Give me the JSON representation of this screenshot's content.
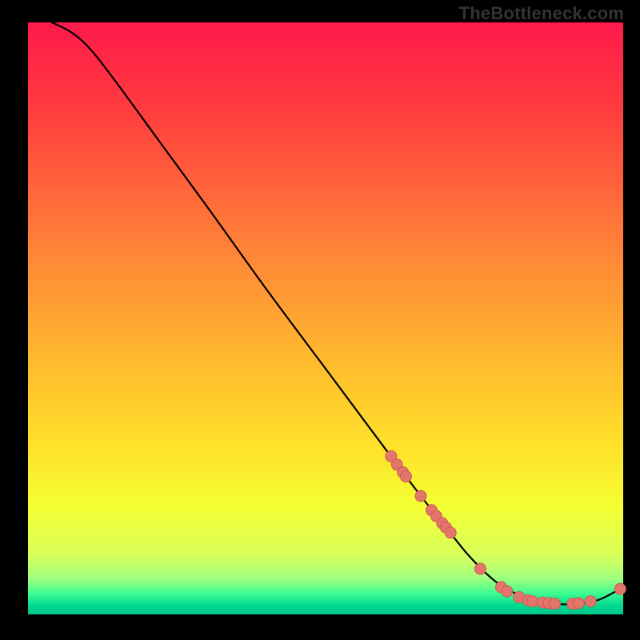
{
  "watermark": "TheBottleneck.com",
  "plot": {
    "inner_x": 35,
    "inner_y": 28,
    "inner_w": 744,
    "inner_h": 740
  },
  "gradient_stops": [
    {
      "offset": 0.0,
      "color": "#ff1a4b"
    },
    {
      "offset": 0.14,
      "color": "#ff3a3f"
    },
    {
      "offset": 0.3,
      "color": "#ff6a3a"
    },
    {
      "offset": 0.46,
      "color": "#ff9a34"
    },
    {
      "offset": 0.6,
      "color": "#ffc22d"
    },
    {
      "offset": 0.72,
      "color": "#ffe22a"
    },
    {
      "offset": 0.82,
      "color": "#f4ff34"
    },
    {
      "offset": 0.9,
      "color": "#d8ff5a"
    },
    {
      "offset": 0.94,
      "color": "#9eff7e"
    },
    {
      "offset": 0.965,
      "color": "#3bfc92"
    },
    {
      "offset": 0.985,
      "color": "#00d98f"
    },
    {
      "offset": 1.0,
      "color": "#00c58a"
    }
  ],
  "colors": {
    "curve": "#000000",
    "marker_fill": "#e2766c",
    "marker_stroke": "#d05a52"
  },
  "marker_radius": 7,
  "chart_data": {
    "type": "line",
    "title": "",
    "xlabel": "",
    "ylabel": "",
    "xlim": [
      0,
      100
    ],
    "ylim": [
      0,
      100
    ],
    "curve": {
      "x": [
        4,
        7,
        10,
        14,
        22,
        30,
        40,
        50,
        60,
        66,
        70,
        74,
        78,
        81,
        84,
        87,
        90,
        93,
        96,
        99.5
      ],
      "y": [
        100,
        98.5,
        96,
        91,
        80,
        69,
        55,
        41.5,
        28,
        20,
        15,
        10,
        6,
        4,
        2.7,
        2.0,
        1.7,
        1.9,
        2.5,
        4.3
      ]
    },
    "markers": {
      "x": [
        61.0,
        62.0,
        63.0,
        63.5,
        66.0,
        67.8,
        68.6,
        69.6,
        70.2,
        71.0,
        76.0,
        79.5,
        80.5,
        82.5,
        84.0,
        84.8,
        86.5,
        87.5,
        88.5,
        91.5,
        92.5,
        94.5,
        99.5
      ],
      "y": [
        26.7,
        25.3,
        24.0,
        23.3,
        20.0,
        17.6,
        16.6,
        15.4,
        14.7,
        13.8,
        7.7,
        4.6,
        3.9,
        2.9,
        2.4,
        2.2,
        2.0,
        1.9,
        1.8,
        1.8,
        1.9,
        2.2,
        4.3
      ]
    }
  }
}
